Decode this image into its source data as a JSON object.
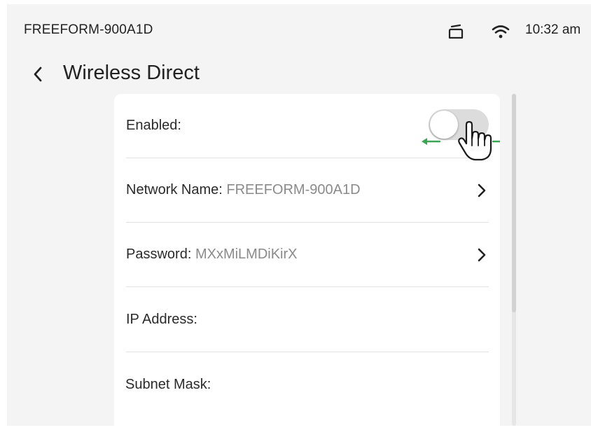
{
  "status_bar": {
    "device_name": "FREEFORM-900A1D",
    "time": "10:32 am",
    "icons": [
      "printer-icon",
      "wifi-icon"
    ]
  },
  "header": {
    "title": "Wireless Direct",
    "back_icon": "chevron-left-icon"
  },
  "settings": {
    "enabled": {
      "label": "Enabled:",
      "state": "off"
    },
    "network_name": {
      "label": "Network Name:",
      "value": "FREEFORM-900A1D"
    },
    "password": {
      "label": "Password:",
      "value": "MXxMiLMDiKirX"
    },
    "ip_address": {
      "label": "IP Address:"
    },
    "subnet_mask": {
      "label": "Subnet Mask:"
    }
  },
  "annotation": {
    "arrow_color": "#3aa655",
    "gesture": "drag-toggle-right"
  }
}
